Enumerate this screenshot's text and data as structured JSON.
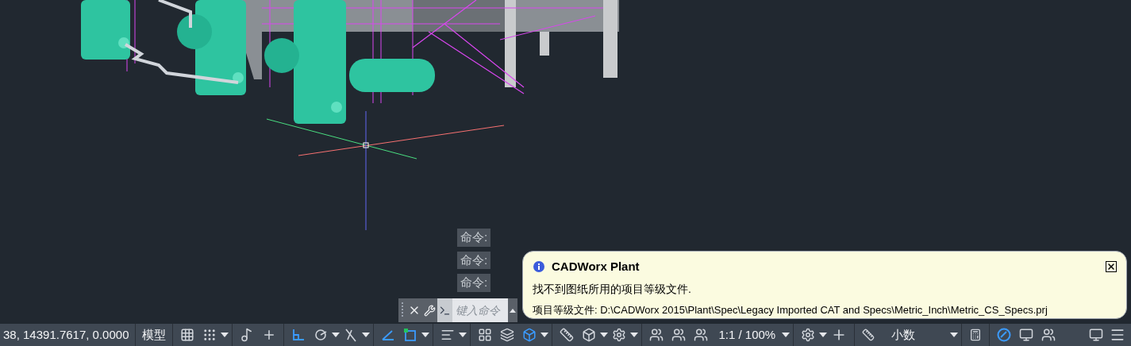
{
  "command_line": {
    "history": [
      "命令:",
      "命令:",
      "命令:"
    ],
    "input": {
      "placeholder": "键入命令"
    }
  },
  "balloon": {
    "title": "CADWorx Plant",
    "message": "找不到图纸所用的项目等级文件.",
    "detail": "项目等级文件: D:\\CADWorx 2015\\Plant\\Spec\\Legacy Imported CAT and Specs\\Metric_Inch\\Metric_CS_Specs.prj"
  },
  "status_bar": {
    "coordinates": "38, 14391.7617, 0.0000",
    "model_tab": "模型",
    "toggles": [
      {
        "on": false
      },
      {
        "on": false
      },
      {
        "on": false
      },
      {
        "on": false
      },
      {
        "on": true
      },
      {
        "on": false
      },
      {
        "on": false
      },
      {
        "on": true
      },
      {
        "on": true
      },
      {
        "on": false
      },
      {
        "on": false
      },
      {
        "on": false
      },
      {
        "on": true
      }
    ],
    "annotation_scale": "1:1 / 100%",
    "units": "小数"
  }
}
